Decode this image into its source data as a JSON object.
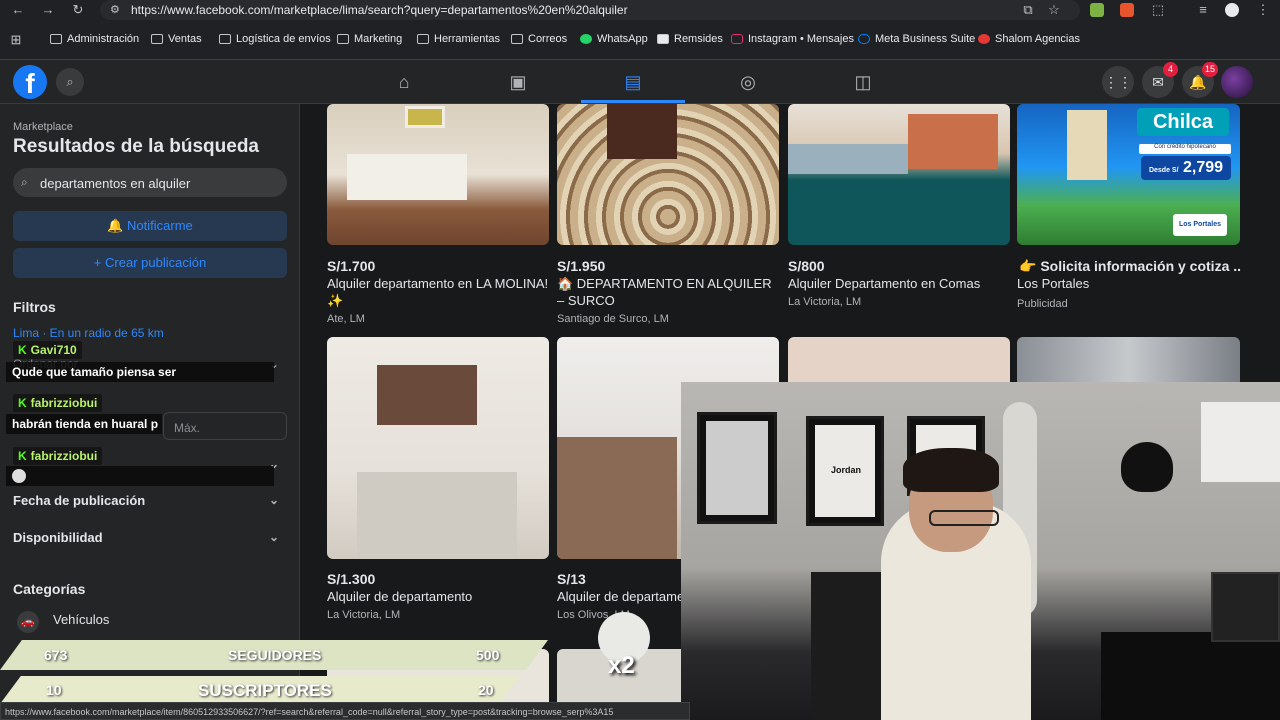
{
  "browser": {
    "url": "https://www.facebook.com/marketplace/lima/search?query=departamentos%20en%20alquiler",
    "bookmarks": [
      "Administración",
      "Ventas",
      "Logística de envíos",
      "Marketing",
      "Herramientas",
      "Correos",
      "WhatsApp",
      "Remsides",
      "Instagram • Mensajes",
      "Meta Business Suite",
      "Shalom Agencias"
    ],
    "status_url": "https://www.facebook.com/marketplace/item/860512933506627/?ref=search&referral_code=null&referral_story_type=post&tracking=browse_serp%3A15"
  },
  "topbar": {
    "logo": "f",
    "messenger_badge": "4",
    "notifications_badge": "15"
  },
  "sidebar": {
    "small_label": "Marketplace",
    "title": "Resultados de la búsqueda",
    "search_value": "departamentos en alquiler",
    "notify_label": "Notificarme",
    "create_label": "Crear publicación",
    "filters_heading": "Filtros",
    "location_link": "Lima · En un radio de 65 km",
    "sort_label": "Ordenar por",
    "max_placeholder": "Máx.",
    "date_label": "Fecha de publicación",
    "availability_label": "Disponibilidad",
    "categories_heading": "Categorías",
    "vehicles_label": "Vehículos"
  },
  "chat": {
    "user1": "Gavi710",
    "msg1": "Qude que tamaño piensa ser",
    "user2": "fabrizziobui",
    "msg2": "habrán tienda en huaral p",
    "user3": "fabrizziobui"
  },
  "listings": [
    {
      "price": "S/1.700",
      "title": "Alquiler departamento en LA MOLINA! ✨",
      "location": "Ate, LM"
    },
    {
      "price": "S/1.950",
      "title": "🏠 DEPARTAMENTO EN ALQUILER – SURCO",
      "location": "Santiago de Surco, LM"
    },
    {
      "price": "S/800",
      "title": "Alquiler Departamento en Comas",
      "location": "La Victoria, LM"
    },
    {
      "price": "👉 Solicita información y cotiza ...",
      "title": "Los Portales",
      "location": "Publicidad"
    },
    {
      "price": "S/1.300",
      "title": "Alquiler de departamento",
      "location": "La Victoria, LM"
    },
    {
      "price": "S/13",
      "title": "Alquiler de departame",
      "location": "Los Olivos, LM"
    }
  ],
  "ad": {
    "brand": "Chilca",
    "price_prefix": "Desde S/",
    "price": "2,799",
    "logo_text": "Los Portales",
    "credit_text": "Con crédito hipotecario"
  },
  "overlay": {
    "row1": {
      "left": "673",
      "label": "SEGUIDORES",
      "right": "500"
    },
    "row2": {
      "left": "10",
      "label": "SUSCRIPTORES",
      "right": "20"
    },
    "multiplier": "x2",
    "poster_text": "Jordan"
  },
  "colors": {
    "accent": "#2d88ff",
    "fb_blue": "#1877f2",
    "badge_red": "#e41e3f",
    "kick_green": "#53fc18"
  }
}
